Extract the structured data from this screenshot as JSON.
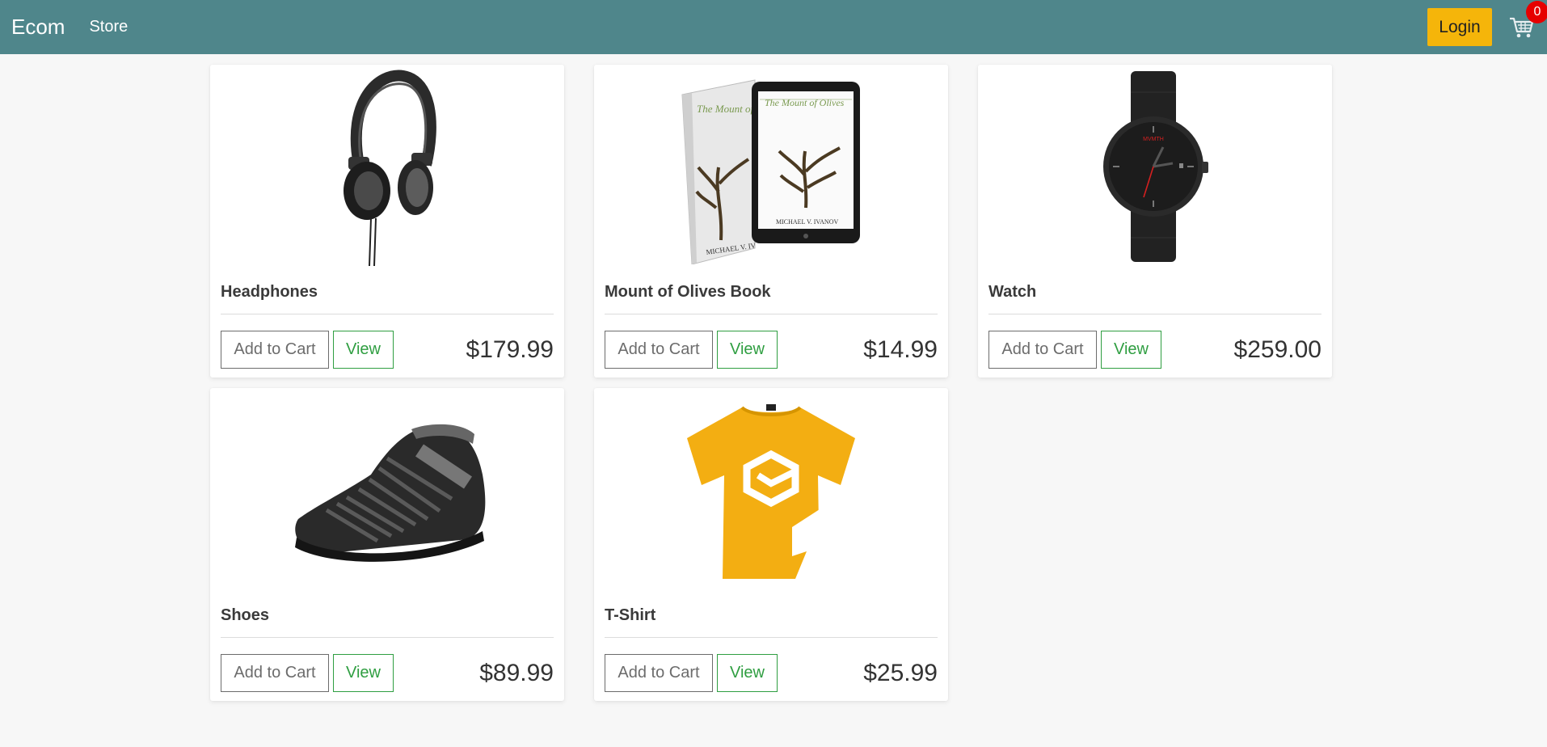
{
  "nav": {
    "brand": "Ecom",
    "store_link": "Store",
    "login_label": "Login",
    "cart_count": "0",
    "accent_color": "#4f868b",
    "login_color": "#f5b50a"
  },
  "products": [
    {
      "name": "Headphones",
      "price": "$179.99",
      "add_label": "Add to Cart",
      "view_label": "View",
      "image_icon": "headphones-image"
    },
    {
      "name": "Mount of Olives Book",
      "price": "$14.99",
      "add_label": "Add to Cart",
      "view_label": "View",
      "image_icon": "book-image"
    },
    {
      "name": "Watch",
      "price": "$259.00",
      "add_label": "Add to Cart",
      "view_label": "View",
      "image_icon": "watch-image"
    },
    {
      "name": "Shoes",
      "price": "$89.99",
      "add_label": "Add to Cart",
      "view_label": "View",
      "image_icon": "shoe-image"
    },
    {
      "name": "T-Shirt",
      "price": "$25.99",
      "add_label": "Add to Cart",
      "view_label": "View",
      "image_icon": "tshirt-image"
    }
  ],
  "book_cover": {
    "title": "The Mount of Olives",
    "author": "MICHAEL V. IVANOV"
  },
  "watch_brand": "MVMTH"
}
